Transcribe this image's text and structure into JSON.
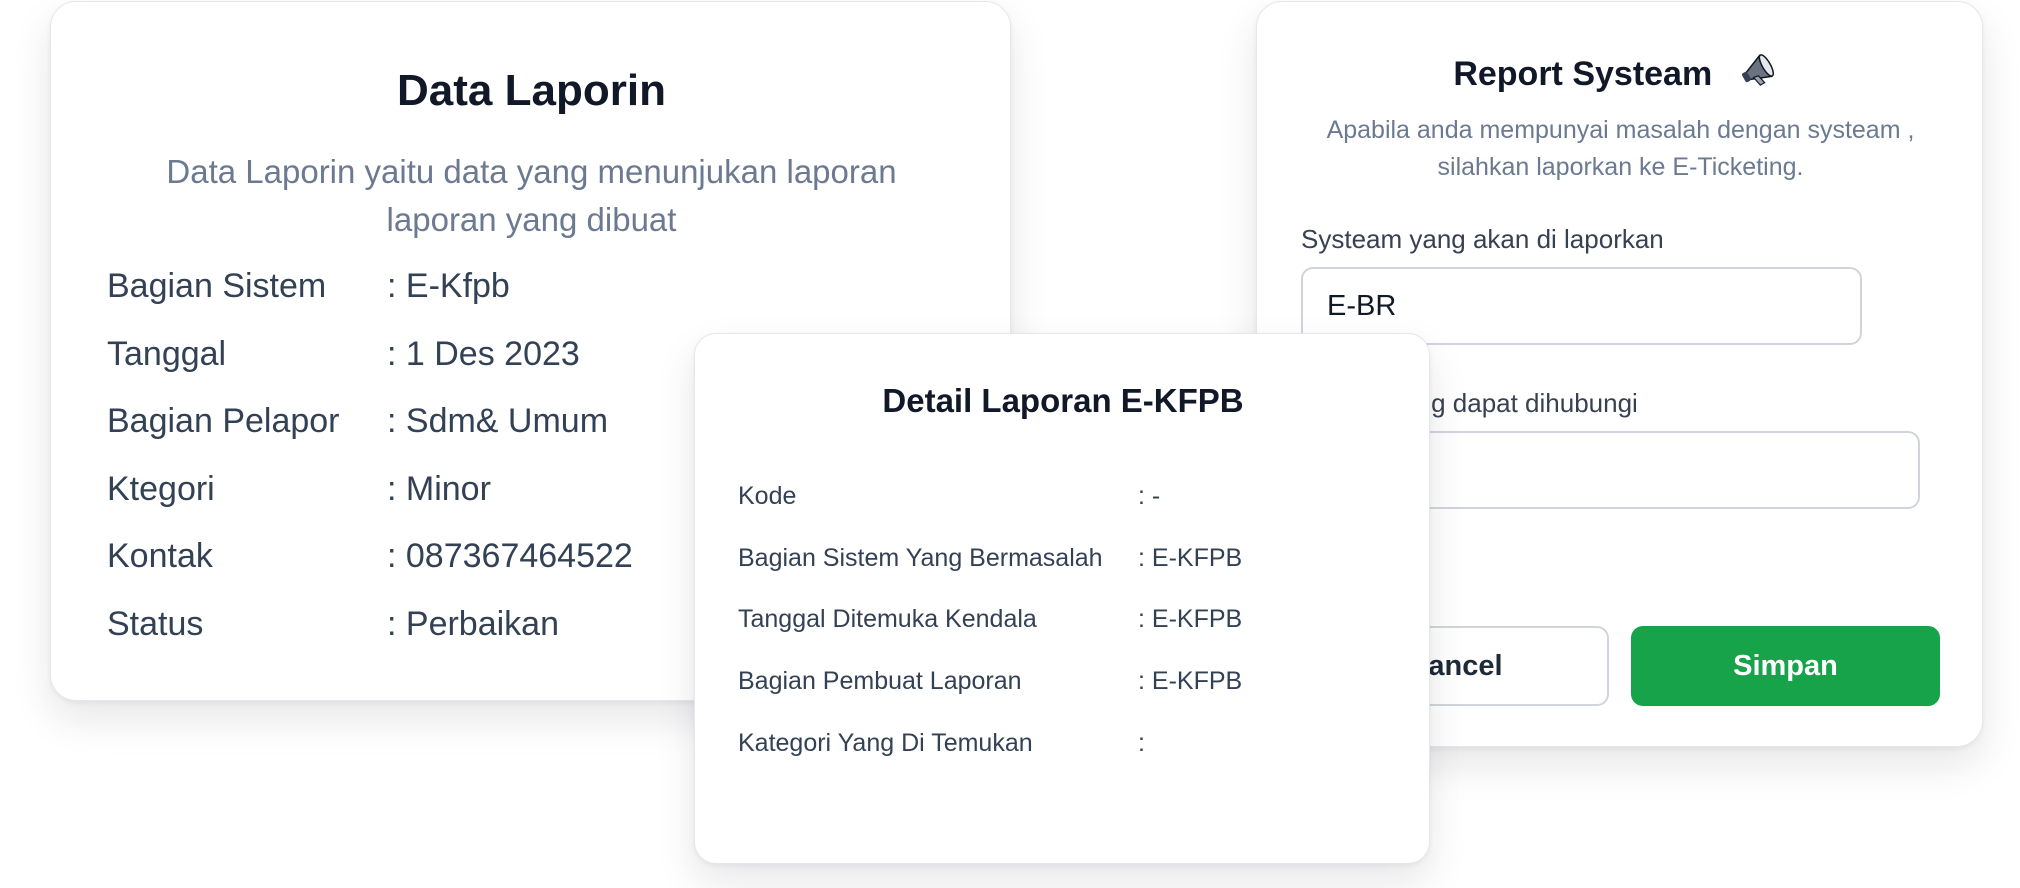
{
  "data_card": {
    "title": "Data Laporin",
    "subtitle": "Data Laporin yaitu data yang menunjukan laporan laporan yang dibuat",
    "rows": [
      {
        "label": "Bagian Sistem",
        "value": ":  E-Kfpb"
      },
      {
        "label": "Tanggal",
        "value": ": 1 Des 2023"
      },
      {
        "label": "Bagian Pelapor",
        "value": ": Sdm& Umum"
      },
      {
        "label": "Ktegori",
        "value": ": Minor"
      },
      {
        "label": "Kontak",
        "value": ": 087367464522"
      },
      {
        "label": "Status",
        "value": ": Perbaikan"
      }
    ]
  },
  "report_card": {
    "title": "Report Systeam",
    "title_icon": "megaphone-icon",
    "description": "Apabila anda mempunyai masalah dengan systeam , silahkan laporkan ke E-Ticketing.",
    "field_system": {
      "label": "Systeam yang akan di laporkan",
      "value": "E-BR"
    },
    "field_contact": {
      "label": "Kontak yang dapat dihubungi",
      "value": ""
    },
    "cancel_label": "Cancel",
    "save_label": "Simpan",
    "accent_color": "#16a34a"
  },
  "detail_card": {
    "title": "Detail Laporan E-KFPB",
    "rows": [
      {
        "label": "Kode",
        "value": ": -"
      },
      {
        "label": "Bagian Sistem Yang Bermasalah",
        "value": ": E-KFPB"
      },
      {
        "label": "Tanggal Ditemuka Kendala",
        "value": ": E-KFPB"
      },
      {
        "label": "Bagian Pembuat Laporan",
        "value": ": E-KFPB"
      },
      {
        "label": "Kategori Yang Di Temukan",
        "value": ":"
      }
    ]
  }
}
